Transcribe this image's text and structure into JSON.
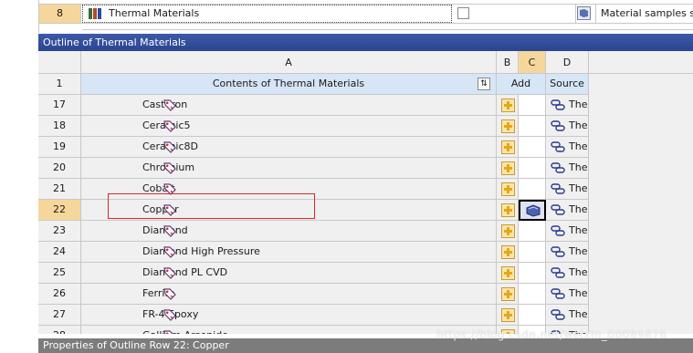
{
  "top_row": {
    "number": "8",
    "name": "Thermal Materials",
    "description": "Material samples specific for use in a thermal analysis."
  },
  "outline": {
    "title": "Outline of Thermal Materials",
    "columns": [
      "A",
      "B",
      "C",
      "D"
    ],
    "header_row_number": "1",
    "header_contents": "Contents of Thermal Materials",
    "header_add": "Add",
    "header_source": "Source",
    "rows": [
      {
        "num": "17",
        "name": "Cast Iron",
        "source": "The"
      },
      {
        "num": "18",
        "name": "Ceramic5",
        "source": "The"
      },
      {
        "num": "19",
        "name": "Ceramic8D",
        "source": "The"
      },
      {
        "num": "20",
        "name": "Chromium",
        "source": "The"
      },
      {
        "num": "21",
        "name": "Cobalt",
        "source": "The"
      },
      {
        "num": "22",
        "name": "Copper",
        "source": "The"
      },
      {
        "num": "23",
        "name": "Diamond",
        "source": "The"
      },
      {
        "num": "24",
        "name": "Diamond High Pressure",
        "source": "The"
      },
      {
        "num": "25",
        "name": "Diamond PL CVD",
        "source": "The"
      },
      {
        "num": "26",
        "name": "Ferrite",
        "source": "The"
      },
      {
        "num": "27",
        "name": "FR-4 Epoxy",
        "source": "The"
      },
      {
        "num": "28",
        "name": "Gallium Arsenide",
        "source": "The"
      }
    ]
  },
  "properties_title": "Properties of Outline Row 22: Copper",
  "watermark": "https://blog.csdn.net/weixin_00089876",
  "colors": {
    "title_bar": "#2f4a98",
    "selected_header": "#f6d79b",
    "highlight_box": "#e0242b",
    "properties_bar": "#7c7c7c"
  }
}
